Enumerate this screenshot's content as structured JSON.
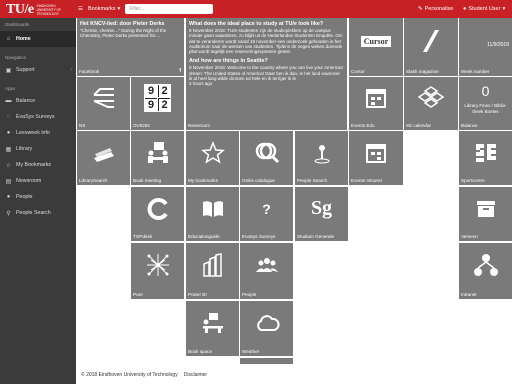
{
  "topbar": {
    "logo_text": "TU/e",
    "logo_sub": "EINDHOVEN UNIVERSITY OF TECHNOLOGY",
    "bookmarks_label": "Bookmarks",
    "filter_placeholder": "Filter...",
    "personalise_label": "Personalise",
    "user_label": "Student User"
  },
  "sidebar": {
    "dashboards_header": "Dashboards",
    "home": "Home",
    "navigation_header": "Navigation",
    "support": "Support",
    "apps_header": "Apps",
    "items": [
      "Balance",
      "EvaSys Surveys",
      "Leesweek info",
      "Library",
      "My Bookmarks",
      "Newsroom",
      "People",
      "People Search"
    ]
  },
  "tiles": {
    "facebook": {
      "title": "Het KNCV-lied: door Pieter Derks",
      "body": "“Chemie, chemie…” During the Night of the Chemistry, Pieter Derks presented his ...",
      "label": "Facebook"
    },
    "news1": {
      "title": "What does the ideal place to study at TU/e look like?",
      "body": "8 November 2018: TU/e-studenten zijn de studieplekken op de campus minder gaan waarderen, zo blijkt uit de Nederlandse Studenten Enquête. Om dat te veranderen wordt vanaf 19 november een onderzoek gehouden in het Auditorium naar de wensen van studenten. Tijdens de negen weken durende pilot wordt tegelijk een reserveringssysteem getest.",
      "title2": "And how are things in Seattle?",
      "body2": "9 November 2018: Welcome to the country where you can live your American dream: The United States of America! Daar ben ik dan, in het land waarover ik al heel lang wilde dromen tot hele en ik terriger ik le",
      "time": "3 hours ago",
      "label": "Newsroom"
    },
    "cursor": {
      "logo": "Cursor",
      "label": "Cursor"
    },
    "slash": {
      "label": "Slash magazine"
    },
    "week": {
      "date": "11/9/2018",
      "label": "Week number"
    },
    "ns": {
      "label": "NS"
    },
    "ov": {
      "digits": [
        "9",
        "2",
        "9",
        "2"
      ],
      "label": "OV9292"
    },
    "events_edu": {
      "label": "Events Edu"
    },
    "se_calendar": {
      "label": "SE calendar"
    },
    "balance": {
      "amount": "0",
      "desc": "Library Fines / Biblio-theek Boetes",
      "label": "Balance"
    },
    "library_search": {
      "label": "LibrarySearch"
    },
    "book_meeting": {
      "label": "Book meeting"
    },
    "my_bookmarks": {
      "label": "My bookmarks"
    },
    "osiris": {
      "label": "Osiris catalogue"
    },
    "people_search": {
      "label": "People Search"
    },
    "events_intranet": {
      "label": "Events Intranet"
    },
    "sportscentre": {
      "label": "Sportcentre"
    },
    "topdesk": {
      "label": "TOPdesk"
    },
    "educationguide": {
      "label": "Educationguide"
    },
    "evasys": {
      "label": "EvaSys Surveys"
    },
    "studium": {
      "label": "Studium Generale"
    },
    "verseon": {
      "label": "Verseon"
    },
    "pure": {
      "label": "Pure"
    },
    "powerbi": {
      "label": "Power BI"
    },
    "people": {
      "label": "People"
    },
    "intranet": {
      "label": "Intranet"
    },
    "bookspace": {
      "label": "Book space"
    },
    "weather": {
      "label": "Weather"
    }
  },
  "footer": {
    "copyright": "© 2018 Eindhoven University of Technology",
    "disclaimer": "Disclaimer"
  },
  "colors": {
    "brand": "#c72125",
    "tile": "#7a7a7a",
    "sidebar": "#3b3b3b"
  },
  "icons": [
    "home-icon",
    "support-icon",
    "bookmarks-icon",
    "personalise-icon",
    "user-icon"
  ]
}
